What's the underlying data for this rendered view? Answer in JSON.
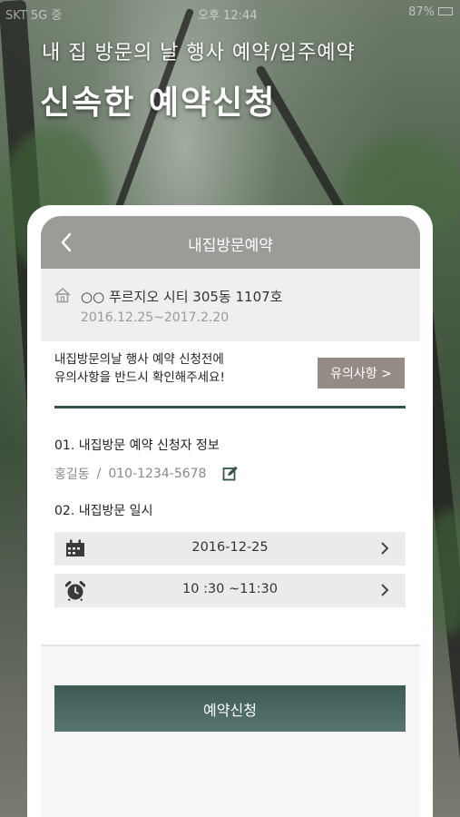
{
  "status_bar": {
    "left": "SKT 5G 중",
    "time": "오후 12:44",
    "battery": "87%"
  },
  "hero": {
    "subtitle": "내 집 방문의 날 행사 예약/입주예약",
    "title": "신속한 예약신청"
  },
  "header": {
    "title": "내집방문예약",
    "back_icon": "chevron-left-icon"
  },
  "address": {
    "icon": "home-icon",
    "name": "○○ 푸르지오 시티 305동 1107호",
    "period": "2016.12.25~2017.2.20"
  },
  "notice": {
    "line1": "내집방문의날 행사 예약 신청전에",
    "line2": "유의사항을 반드시 확인해주세요!",
    "button_label": "유의사항 >"
  },
  "section1": {
    "title": "01. 내집방문 예약 신청자 정보",
    "name": "홍길동",
    "separator": "/",
    "phone": "010-1234-5678",
    "edit_icon": "edit-icon"
  },
  "section2": {
    "title": "02. 내집방문 일시",
    "date": "2016-12-25",
    "time": "10 :30 ~11:30",
    "date_icon": "calendar-icon",
    "time_icon": "alarm-clock-icon"
  },
  "submit": {
    "label": "예약신청"
  },
  "colors": {
    "header": "#9b9b98",
    "accent": "#35524d",
    "notice_button": "#948c84",
    "submit": "#3d5a55"
  }
}
